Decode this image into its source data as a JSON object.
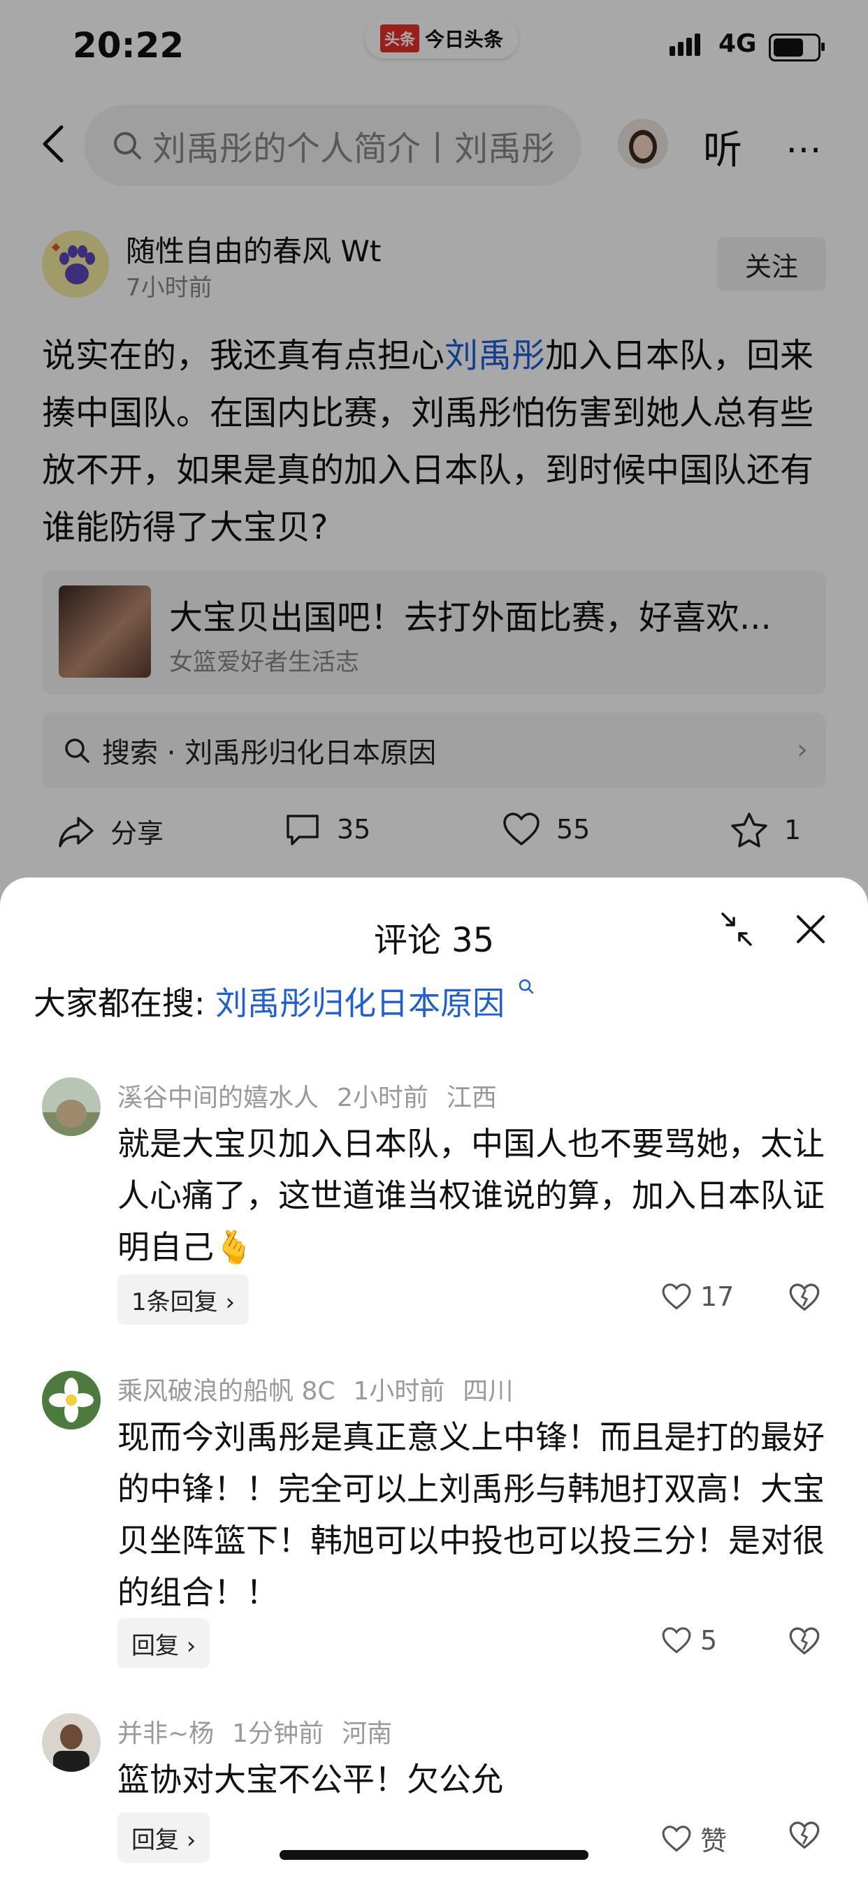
{
  "status_bar": {
    "time": "20:22",
    "app_logo": "头条",
    "app_name": "今日头条",
    "network": "4G"
  },
  "nav": {
    "search_text": "刘禹彤的个人简介丨刘禹彤",
    "listen_label": "听",
    "more_label": "⋯"
  },
  "author": {
    "name": "随性自由的春风 Wt",
    "time": "7小时前",
    "follow_label": "关注"
  },
  "post": {
    "text_before": "说实在的，我还真有点担心",
    "highlight": "刘禹彤",
    "text_after": "加入日本队，回来揍中国队。在国内比赛，刘禹彤怕伤害到她人总有些放不开，如果是真的加入日本队，到时候中国队还有谁能防得了大宝贝?"
  },
  "card": {
    "title": "大宝贝出国吧！去打外面比赛，好喜欢...",
    "source": "女篮爱好者生活志"
  },
  "search_suggestion": {
    "text": "搜索 · 刘禹彤归化日本原因",
    "chevron": "›"
  },
  "actions": {
    "share": "分享",
    "comments": "35",
    "likes": "55",
    "favorites": "1"
  },
  "sheet": {
    "title": "评论 35",
    "hot_search_label": "大家都在搜: ",
    "hot_search_link": "刘禹彤归化日本原因"
  },
  "comments": [
    {
      "user": "溪谷中间的嬉水人",
      "time": "2小时前",
      "location": "江西",
      "text": "就是大宝贝加入日本队，中国人也不要骂她，太让人心痛了，这世道谁当权谁说的算，加入日本队证明自己🫰",
      "reply_label": "1条回复 ›",
      "likes": "17"
    },
    {
      "user": "乘风破浪的船帆 8C",
      "time": "1小时前",
      "location": "四川",
      "text": "现而今刘禹彤是真正意义上中锋！而且是打的最好的中锋！！完全可以上刘禹彤与韩旭打双高！大宝贝坐阵篮下！韩旭可以中投也可以投三分！是对很的组合！！",
      "reply_label": "回复 ›",
      "likes": "5"
    },
    {
      "user": "并非~杨",
      "time": "1分钟前",
      "location": "河南",
      "text": "篮协对大宝不公平！欠公允",
      "reply_label": "回复 ›",
      "likes": "赞"
    }
  ],
  "colors": {
    "link": "#1e5fd8",
    "logo_red": "#e8302d"
  }
}
